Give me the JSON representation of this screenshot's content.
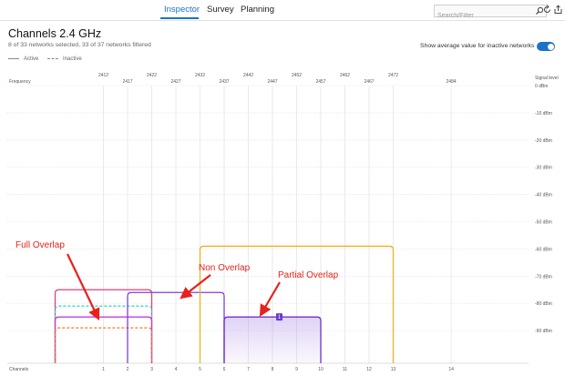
{
  "tabs": [
    {
      "label": "Inspector",
      "active": true
    },
    {
      "label": "Survey",
      "active": false
    },
    {
      "label": "Planning",
      "active": false
    }
  ],
  "search": {
    "placeholder": "Search/Filter"
  },
  "icons": [
    "search-icon",
    "refresh-icon",
    "export-icon"
  ],
  "header": {
    "title": "Channels 2.4 GHz",
    "subtitle": "8 of 33 networks selected, 33 of 37 networks filtered",
    "legend_active": "Active",
    "legend_inactive": "Inactive",
    "toggle_label": "Show average value for inactive networks",
    "toggle_on": true
  },
  "chart_data": {
    "type": "area",
    "freq_axis_label": "Frequency",
    "signal_axis_label": "Signal level",
    "channels_axis_label": "Channels",
    "freq_ticks_upper": [
      2412,
      2422,
      2432,
      2442,
      2452,
      2462,
      2472
    ],
    "freq_ticks_lower": [
      2417,
      2427,
      2437,
      2447,
      2457,
      2467
    ],
    "freq_tick_2484": 2484,
    "channels": [
      1,
      2,
      3,
      4,
      5,
      6,
      7,
      8,
      9,
      10,
      11,
      12,
      13,
      14
    ],
    "signal_ticks": [
      "0 dBm",
      "-10 dBm",
      "-20 dBm",
      "-30 dBm",
      "-40 dBm",
      "-50 dBm",
      "-60 dBm",
      "-70 dBm",
      "-80 dBm",
      "-90 dBm"
    ],
    "signal_range": [
      -102,
      0
    ],
    "networks": [
      {
        "channel": 1,
        "width": 20,
        "level": -75,
        "color": "#e0407a",
        "style": "solid"
      },
      {
        "channel": 1,
        "width": 20,
        "level": -81,
        "color": "#40d8b8",
        "style": "dashed"
      },
      {
        "channel": 1,
        "width": 20,
        "level": -85,
        "color": "#c040d8",
        "style": "solid"
      },
      {
        "channel": 1,
        "width": 20,
        "level": -89,
        "color": "#f08020",
        "style": "dashed"
      },
      {
        "channel": 4,
        "width": 20,
        "level": -76,
        "color": "#8040d8",
        "style": "solid"
      },
      {
        "channel": 8,
        "width": 20,
        "level": -85,
        "color": "#7030c8",
        "style": "solid",
        "fill": true
      },
      {
        "channel": 11,
        "width": 40,
        "level": -59,
        "color": "#f0b020",
        "style": "solid"
      }
    ],
    "badge": {
      "text": "1"
    },
    "annotations": {
      "full_overlap": "Full Overlap",
      "non_overlap": "Non Overlap",
      "partial_overlap": "Partial Overlap"
    }
  }
}
